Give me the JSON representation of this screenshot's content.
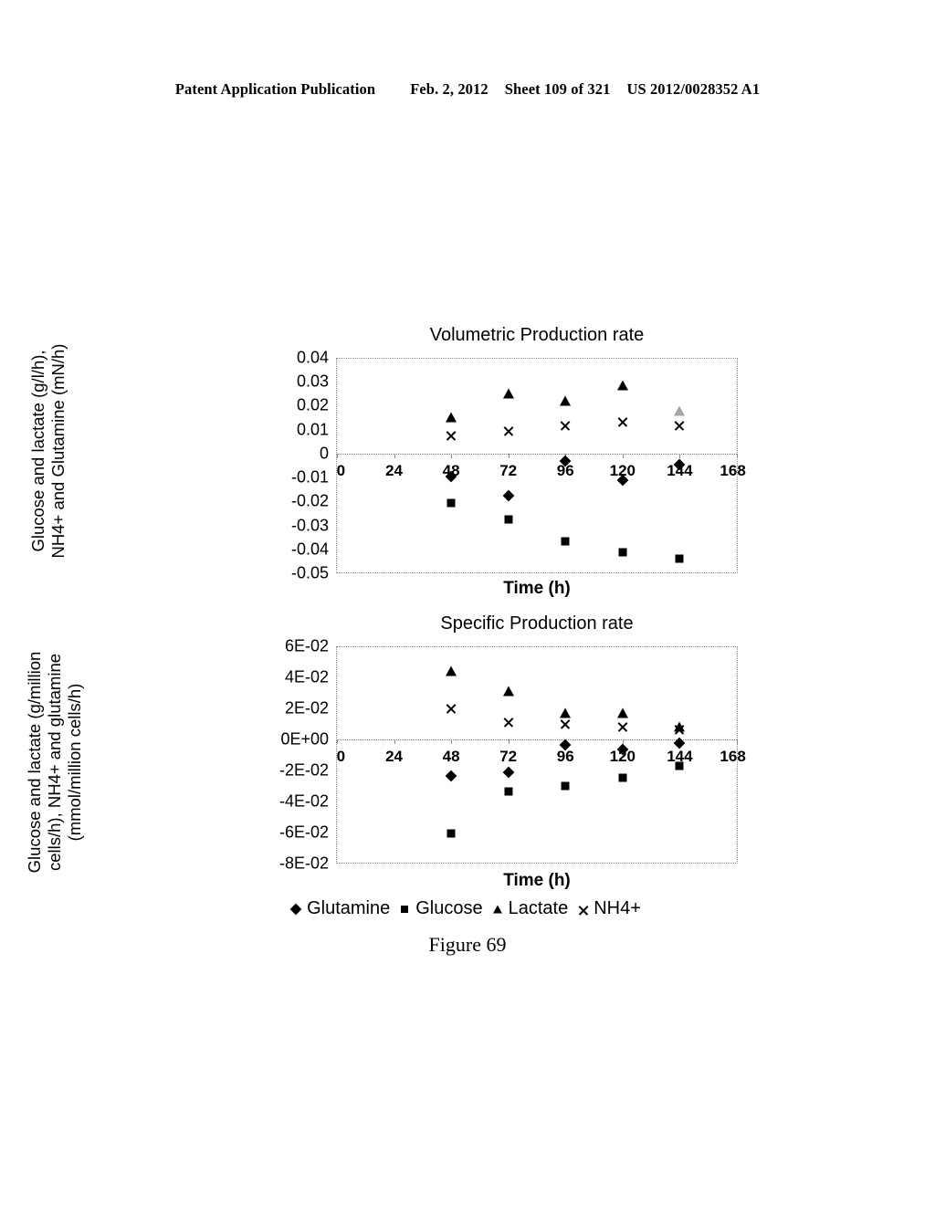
{
  "header": {
    "publication": "Patent Application Publication",
    "date": "Feb. 2, 2012",
    "sheet": "Sheet 109 of 321",
    "number": "US 2012/0028352 A1"
  },
  "figure": {
    "caption": "Figure 69"
  },
  "legend": {
    "items": [
      {
        "label": "Glutamine",
        "marker": "diamond"
      },
      {
        "label": "Glucose",
        "marker": "square"
      },
      {
        "label": "Lactate",
        "marker": "triangle"
      },
      {
        "label": "NH4+",
        "marker": "cross"
      }
    ]
  },
  "chart_data": [
    {
      "type": "scatter",
      "title": "Volumetric Production rate",
      "xlabel": "Time (h)",
      "ylabel": "Glucose and lactate (g/l/h), NH4+ and Glutamine (mN/h)",
      "ylabel_lines": [
        "Glucose and lactate (g/l/h),",
        "NH4+ and Glutamine (mN/h)"
      ],
      "xlim": [
        0,
        168
      ],
      "ylim": [
        -0.05,
        0.04
      ],
      "xticks": [
        "0",
        "24",
        "48",
        "72",
        "96",
        "120",
        "144",
        "168"
      ],
      "xtick_values": [
        0,
        24,
        48,
        72,
        96,
        120,
        144,
        168
      ],
      "yticks": [
        "0.04",
        "0.03",
        "0.02",
        "0.01",
        "0",
        "-0.01",
        "-0.02",
        "-0.03",
        "-0.04",
        "-0.05"
      ],
      "ytick_values": [
        0.04,
        0.03,
        0.02,
        0.01,
        0,
        -0.01,
        -0.02,
        -0.03,
        -0.04,
        -0.05
      ],
      "grid": false,
      "legend_position": "bottom-shared",
      "x": [
        48,
        72,
        96,
        120,
        144
      ],
      "series": [
        {
          "name": "Glutamine",
          "marker": "diamond",
          "values": [
            -0.0095,
            -0.0175,
            -0.003,
            -0.011,
            -0.0045
          ]
        },
        {
          "name": "Glucose",
          "marker": "square",
          "values": [
            -0.0208,
            -0.0275,
            -0.037,
            -0.0415,
            -0.0442
          ]
        },
        {
          "name": "Lactate",
          "marker": "triangle",
          "values": [
            0.0153,
            0.0255,
            0.0222,
            0.0288,
            0.018
          ]
        },
        {
          "name": "NH4+",
          "marker": "cross",
          "values": [
            0.0077,
            0.0098,
            0.012,
            0.0133,
            0.0117
          ]
        }
      ]
    },
    {
      "type": "scatter",
      "title": "Specific Production rate",
      "xlabel": "Time (h)",
      "ylabel": "Glucose and lactate (g/million cells/h), NH4+ and glutamine (mmol/million cells/h)",
      "ylabel_lines": [
        "Glucose and lactate (g/million",
        "cells/h), NH4+ and glutamine",
        "(mmol/million cells/h)"
      ],
      "xlim": [
        0,
        168
      ],
      "ylim": [
        -0.08,
        0.06
      ],
      "xticks": [
        "0",
        "24",
        "48",
        "72",
        "96",
        "120",
        "144",
        "168"
      ],
      "xtick_values": [
        0,
        24,
        48,
        72,
        96,
        120,
        144,
        168
      ],
      "yticks": [
        "6E-02",
        "4E-02",
        "2E-02",
        "0E+00",
        "-2E-02",
        "-4E-02",
        "-6E-02",
        "-8E-02"
      ],
      "ytick_values": [
        0.06,
        0.04,
        0.02,
        0.0,
        -0.02,
        -0.04,
        -0.06,
        -0.08
      ],
      "grid": false,
      "legend_position": "bottom-shared",
      "x": [
        48,
        72,
        96,
        120,
        144
      ],
      "series": [
        {
          "name": "Glutamine",
          "marker": "diamond",
          "values": [
            -0.0235,
            -0.0215,
            -0.0035,
            -0.0065,
            -0.002
          ]
        },
        {
          "name": "Glucose",
          "marker": "square",
          "values": [
            -0.061,
            -0.0335,
            -0.0305,
            -0.0245,
            -0.017
          ]
        },
        {
          "name": "Lactate",
          "marker": "triangle",
          "values": [
            0.0445,
            0.0315,
            0.0175,
            0.017,
            0.0082
          ]
        },
        {
          "name": "NH4+",
          "marker": "cross",
          "values": [
            0.0205,
            0.0115,
            0.0102,
            0.0085,
            0.0068
          ]
        }
      ]
    }
  ]
}
